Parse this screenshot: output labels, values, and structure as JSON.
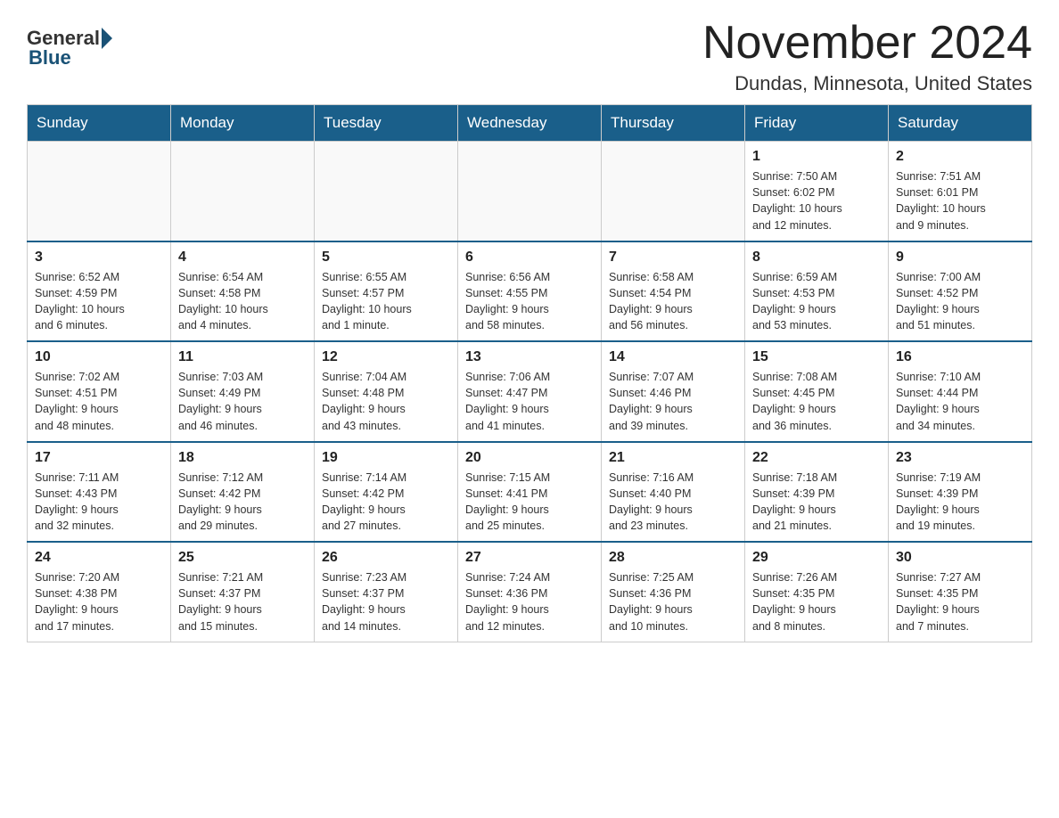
{
  "logo": {
    "general": "General",
    "blue": "Blue"
  },
  "header": {
    "title": "November 2024",
    "subtitle": "Dundas, Minnesota, United States"
  },
  "weekdays": [
    "Sunday",
    "Monday",
    "Tuesday",
    "Wednesday",
    "Thursday",
    "Friday",
    "Saturday"
  ],
  "weeks": [
    [
      {
        "day": "",
        "info": ""
      },
      {
        "day": "",
        "info": ""
      },
      {
        "day": "",
        "info": ""
      },
      {
        "day": "",
        "info": ""
      },
      {
        "day": "",
        "info": ""
      },
      {
        "day": "1",
        "info": "Sunrise: 7:50 AM\nSunset: 6:02 PM\nDaylight: 10 hours\nand 12 minutes."
      },
      {
        "day": "2",
        "info": "Sunrise: 7:51 AM\nSunset: 6:01 PM\nDaylight: 10 hours\nand 9 minutes."
      }
    ],
    [
      {
        "day": "3",
        "info": "Sunrise: 6:52 AM\nSunset: 4:59 PM\nDaylight: 10 hours\nand 6 minutes."
      },
      {
        "day": "4",
        "info": "Sunrise: 6:54 AM\nSunset: 4:58 PM\nDaylight: 10 hours\nand 4 minutes."
      },
      {
        "day": "5",
        "info": "Sunrise: 6:55 AM\nSunset: 4:57 PM\nDaylight: 10 hours\nand 1 minute."
      },
      {
        "day": "6",
        "info": "Sunrise: 6:56 AM\nSunset: 4:55 PM\nDaylight: 9 hours\nand 58 minutes."
      },
      {
        "day": "7",
        "info": "Sunrise: 6:58 AM\nSunset: 4:54 PM\nDaylight: 9 hours\nand 56 minutes."
      },
      {
        "day": "8",
        "info": "Sunrise: 6:59 AM\nSunset: 4:53 PM\nDaylight: 9 hours\nand 53 minutes."
      },
      {
        "day": "9",
        "info": "Sunrise: 7:00 AM\nSunset: 4:52 PM\nDaylight: 9 hours\nand 51 minutes."
      }
    ],
    [
      {
        "day": "10",
        "info": "Sunrise: 7:02 AM\nSunset: 4:51 PM\nDaylight: 9 hours\nand 48 minutes."
      },
      {
        "day": "11",
        "info": "Sunrise: 7:03 AM\nSunset: 4:49 PM\nDaylight: 9 hours\nand 46 minutes."
      },
      {
        "day": "12",
        "info": "Sunrise: 7:04 AM\nSunset: 4:48 PM\nDaylight: 9 hours\nand 43 minutes."
      },
      {
        "day": "13",
        "info": "Sunrise: 7:06 AM\nSunset: 4:47 PM\nDaylight: 9 hours\nand 41 minutes."
      },
      {
        "day": "14",
        "info": "Sunrise: 7:07 AM\nSunset: 4:46 PM\nDaylight: 9 hours\nand 39 minutes."
      },
      {
        "day": "15",
        "info": "Sunrise: 7:08 AM\nSunset: 4:45 PM\nDaylight: 9 hours\nand 36 minutes."
      },
      {
        "day": "16",
        "info": "Sunrise: 7:10 AM\nSunset: 4:44 PM\nDaylight: 9 hours\nand 34 minutes."
      }
    ],
    [
      {
        "day": "17",
        "info": "Sunrise: 7:11 AM\nSunset: 4:43 PM\nDaylight: 9 hours\nand 32 minutes."
      },
      {
        "day": "18",
        "info": "Sunrise: 7:12 AM\nSunset: 4:42 PM\nDaylight: 9 hours\nand 29 minutes."
      },
      {
        "day": "19",
        "info": "Sunrise: 7:14 AM\nSunset: 4:42 PM\nDaylight: 9 hours\nand 27 minutes."
      },
      {
        "day": "20",
        "info": "Sunrise: 7:15 AM\nSunset: 4:41 PM\nDaylight: 9 hours\nand 25 minutes."
      },
      {
        "day": "21",
        "info": "Sunrise: 7:16 AM\nSunset: 4:40 PM\nDaylight: 9 hours\nand 23 minutes."
      },
      {
        "day": "22",
        "info": "Sunrise: 7:18 AM\nSunset: 4:39 PM\nDaylight: 9 hours\nand 21 minutes."
      },
      {
        "day": "23",
        "info": "Sunrise: 7:19 AM\nSunset: 4:39 PM\nDaylight: 9 hours\nand 19 minutes."
      }
    ],
    [
      {
        "day": "24",
        "info": "Sunrise: 7:20 AM\nSunset: 4:38 PM\nDaylight: 9 hours\nand 17 minutes."
      },
      {
        "day": "25",
        "info": "Sunrise: 7:21 AM\nSunset: 4:37 PM\nDaylight: 9 hours\nand 15 minutes."
      },
      {
        "day": "26",
        "info": "Sunrise: 7:23 AM\nSunset: 4:37 PM\nDaylight: 9 hours\nand 14 minutes."
      },
      {
        "day": "27",
        "info": "Sunrise: 7:24 AM\nSunset: 4:36 PM\nDaylight: 9 hours\nand 12 minutes."
      },
      {
        "day": "28",
        "info": "Sunrise: 7:25 AM\nSunset: 4:36 PM\nDaylight: 9 hours\nand 10 minutes."
      },
      {
        "day": "29",
        "info": "Sunrise: 7:26 AM\nSunset: 4:35 PM\nDaylight: 9 hours\nand 8 minutes."
      },
      {
        "day": "30",
        "info": "Sunrise: 7:27 AM\nSunset: 4:35 PM\nDaylight: 9 hours\nand 7 minutes."
      }
    ]
  ]
}
